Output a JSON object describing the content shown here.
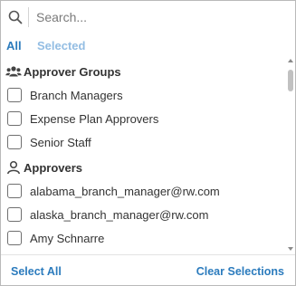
{
  "search": {
    "placeholder": "Search...",
    "value": ""
  },
  "tabs": [
    {
      "label": "All",
      "active": true
    },
    {
      "label": "Selected",
      "active": false
    }
  ],
  "groups": [
    {
      "label": "Approver Groups",
      "icon": "user-group-icon",
      "items": [
        {
          "label": "Branch Managers",
          "checked": false
        },
        {
          "label": "Expense Plan Approvers",
          "checked": false
        },
        {
          "label": "Senior Staff",
          "checked": false
        }
      ]
    },
    {
      "label": "Approvers",
      "icon": "user-icon",
      "items": [
        {
          "label": "alabama_branch_manager@rw.com",
          "checked": false
        },
        {
          "label": "alaska_branch_manager@rw.com",
          "checked": false
        },
        {
          "label": "Amy Schnarre",
          "checked": false
        }
      ]
    }
  ],
  "footer": {
    "select_all": "Select All",
    "clear_selections": "Clear Selections"
  },
  "colors": {
    "accent": "#2b7bbd",
    "accent_light": "#93bde3",
    "border": "#b9b9b9"
  }
}
